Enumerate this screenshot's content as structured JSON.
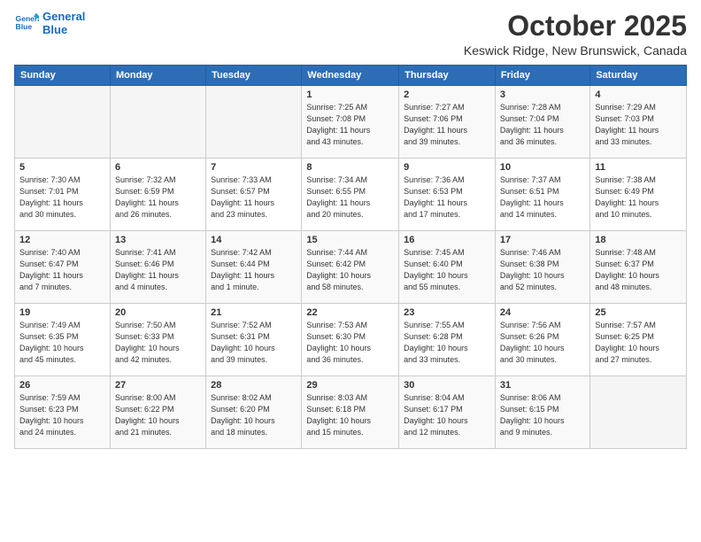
{
  "header": {
    "logo_line1": "General",
    "logo_line2": "Blue",
    "month_title": "October 2025",
    "location": "Keswick Ridge, New Brunswick, Canada"
  },
  "days_of_week": [
    "Sunday",
    "Monday",
    "Tuesday",
    "Wednesday",
    "Thursday",
    "Friday",
    "Saturday"
  ],
  "weeks": [
    [
      {
        "num": "",
        "info": ""
      },
      {
        "num": "",
        "info": ""
      },
      {
        "num": "",
        "info": ""
      },
      {
        "num": "1",
        "info": "Sunrise: 7:25 AM\nSunset: 7:08 PM\nDaylight: 11 hours\nand 43 minutes."
      },
      {
        "num": "2",
        "info": "Sunrise: 7:27 AM\nSunset: 7:06 PM\nDaylight: 11 hours\nand 39 minutes."
      },
      {
        "num": "3",
        "info": "Sunrise: 7:28 AM\nSunset: 7:04 PM\nDaylight: 11 hours\nand 36 minutes."
      },
      {
        "num": "4",
        "info": "Sunrise: 7:29 AM\nSunset: 7:03 PM\nDaylight: 11 hours\nand 33 minutes."
      }
    ],
    [
      {
        "num": "5",
        "info": "Sunrise: 7:30 AM\nSunset: 7:01 PM\nDaylight: 11 hours\nand 30 minutes."
      },
      {
        "num": "6",
        "info": "Sunrise: 7:32 AM\nSunset: 6:59 PM\nDaylight: 11 hours\nand 26 minutes."
      },
      {
        "num": "7",
        "info": "Sunrise: 7:33 AM\nSunset: 6:57 PM\nDaylight: 11 hours\nand 23 minutes."
      },
      {
        "num": "8",
        "info": "Sunrise: 7:34 AM\nSunset: 6:55 PM\nDaylight: 11 hours\nand 20 minutes."
      },
      {
        "num": "9",
        "info": "Sunrise: 7:36 AM\nSunset: 6:53 PM\nDaylight: 11 hours\nand 17 minutes."
      },
      {
        "num": "10",
        "info": "Sunrise: 7:37 AM\nSunset: 6:51 PM\nDaylight: 11 hours\nand 14 minutes."
      },
      {
        "num": "11",
        "info": "Sunrise: 7:38 AM\nSunset: 6:49 PM\nDaylight: 11 hours\nand 10 minutes."
      }
    ],
    [
      {
        "num": "12",
        "info": "Sunrise: 7:40 AM\nSunset: 6:47 PM\nDaylight: 11 hours\nand 7 minutes."
      },
      {
        "num": "13",
        "info": "Sunrise: 7:41 AM\nSunset: 6:46 PM\nDaylight: 11 hours\nand 4 minutes."
      },
      {
        "num": "14",
        "info": "Sunrise: 7:42 AM\nSunset: 6:44 PM\nDaylight: 11 hours\nand 1 minute."
      },
      {
        "num": "15",
        "info": "Sunrise: 7:44 AM\nSunset: 6:42 PM\nDaylight: 10 hours\nand 58 minutes."
      },
      {
        "num": "16",
        "info": "Sunrise: 7:45 AM\nSunset: 6:40 PM\nDaylight: 10 hours\nand 55 minutes."
      },
      {
        "num": "17",
        "info": "Sunrise: 7:46 AM\nSunset: 6:38 PM\nDaylight: 10 hours\nand 52 minutes."
      },
      {
        "num": "18",
        "info": "Sunrise: 7:48 AM\nSunset: 6:37 PM\nDaylight: 10 hours\nand 48 minutes."
      }
    ],
    [
      {
        "num": "19",
        "info": "Sunrise: 7:49 AM\nSunset: 6:35 PM\nDaylight: 10 hours\nand 45 minutes."
      },
      {
        "num": "20",
        "info": "Sunrise: 7:50 AM\nSunset: 6:33 PM\nDaylight: 10 hours\nand 42 minutes."
      },
      {
        "num": "21",
        "info": "Sunrise: 7:52 AM\nSunset: 6:31 PM\nDaylight: 10 hours\nand 39 minutes."
      },
      {
        "num": "22",
        "info": "Sunrise: 7:53 AM\nSunset: 6:30 PM\nDaylight: 10 hours\nand 36 minutes."
      },
      {
        "num": "23",
        "info": "Sunrise: 7:55 AM\nSunset: 6:28 PM\nDaylight: 10 hours\nand 33 minutes."
      },
      {
        "num": "24",
        "info": "Sunrise: 7:56 AM\nSunset: 6:26 PM\nDaylight: 10 hours\nand 30 minutes."
      },
      {
        "num": "25",
        "info": "Sunrise: 7:57 AM\nSunset: 6:25 PM\nDaylight: 10 hours\nand 27 minutes."
      }
    ],
    [
      {
        "num": "26",
        "info": "Sunrise: 7:59 AM\nSunset: 6:23 PM\nDaylight: 10 hours\nand 24 minutes."
      },
      {
        "num": "27",
        "info": "Sunrise: 8:00 AM\nSunset: 6:22 PM\nDaylight: 10 hours\nand 21 minutes."
      },
      {
        "num": "28",
        "info": "Sunrise: 8:02 AM\nSunset: 6:20 PM\nDaylight: 10 hours\nand 18 minutes."
      },
      {
        "num": "29",
        "info": "Sunrise: 8:03 AM\nSunset: 6:18 PM\nDaylight: 10 hours\nand 15 minutes."
      },
      {
        "num": "30",
        "info": "Sunrise: 8:04 AM\nSunset: 6:17 PM\nDaylight: 10 hours\nand 12 minutes."
      },
      {
        "num": "31",
        "info": "Sunrise: 8:06 AM\nSunset: 6:15 PM\nDaylight: 10 hours\nand 9 minutes."
      },
      {
        "num": "",
        "info": ""
      }
    ]
  ]
}
